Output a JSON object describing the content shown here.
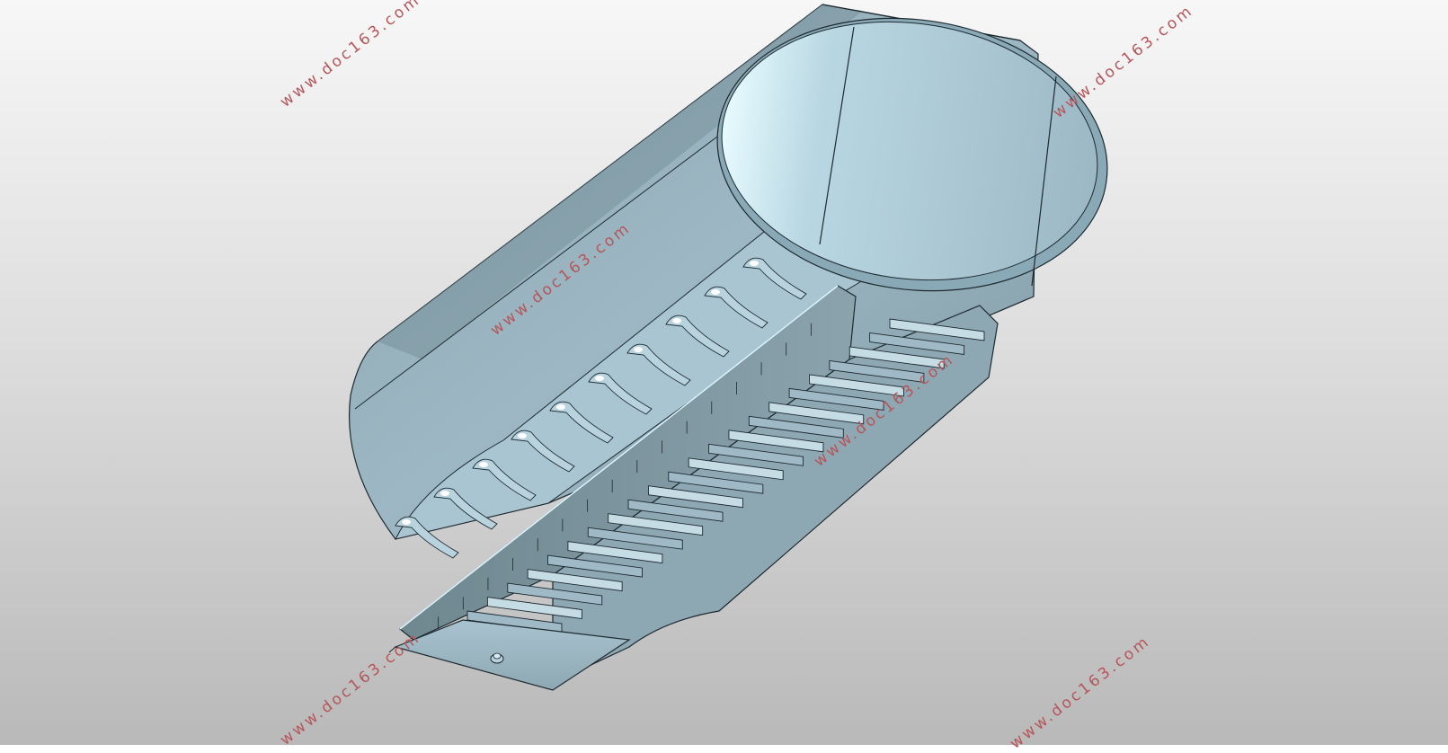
{
  "viewport": {
    "background_top": "#f7f7f7",
    "background_bottom": "#b9b9b9"
  },
  "model": {
    "body_color": "#9cb9c6",
    "edge_color": "#1e2a30",
    "highlight_color": "#dff6ff",
    "shadow_color": "#6f8791",
    "deflector_count": 11,
    "slat_count": 22
  },
  "watermark": {
    "text": "www.doc163.com",
    "color": "#b5565a"
  }
}
